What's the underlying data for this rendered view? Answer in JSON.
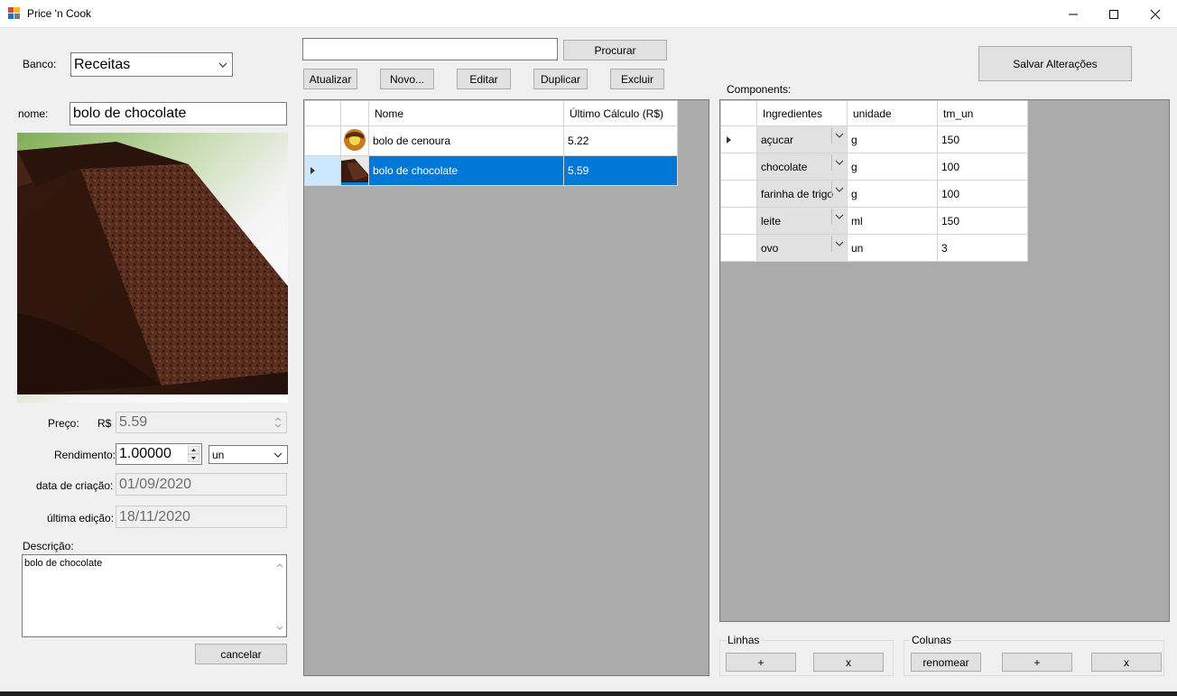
{
  "window": {
    "title": "Price 'n Cook"
  },
  "left": {
    "banco_label": "Banco:",
    "banco_value": "Receitas",
    "nome_label": "nome:",
    "nome_value": "bolo de chocolate",
    "preco_label": "Preço:",
    "currency": "R$",
    "preco_value": "5.59",
    "rendimento_label": "Rendimento:",
    "rendimento_value": "1.00000",
    "unit_value": "un",
    "criacao_label": "data de criação:",
    "criacao_value": "01/09/2020",
    "edicao_label": "última edição:",
    "edicao_value": "18/11/2020",
    "descricao_label": "Descrição:",
    "descricao_value": "bolo de chocolate",
    "cancelar_label": "cancelar"
  },
  "toolbar": {
    "search_value": "",
    "procurar_label": "Procurar",
    "atualizar_label": "Atualizar",
    "novo_label": "Novo...",
    "editar_label": "Editar",
    "duplicar_label": "Duplicar",
    "excluir_label": "Excluir"
  },
  "recipes": {
    "columns": [
      "Nome",
      "Último Cálculo (R$)"
    ],
    "rows": [
      {
        "nome": "bolo de cenoura",
        "valor": "5.22",
        "selected": false
      },
      {
        "nome": "bolo de chocolate",
        "valor": "5.59",
        "selected": true
      }
    ]
  },
  "right": {
    "salvar_label": "Salvar Alterações",
    "components_label": "Components:",
    "columns": [
      "Ingredientes",
      "unidade",
      "tm_un"
    ],
    "rows": [
      {
        "ingrediente": "açucar",
        "unidade": "g",
        "tm_un": "150",
        "current": true
      },
      {
        "ingrediente": "chocolate",
        "unidade": "g",
        "tm_un": "100",
        "current": false
      },
      {
        "ingrediente": "farinha de trigo",
        "unidade": "g",
        "tm_un": "100",
        "current": false
      },
      {
        "ingrediente": "leite",
        "unidade": "ml",
        "tm_un": "150",
        "current": false
      },
      {
        "ingrediente": "ovo",
        "unidade": "un",
        "tm_un": "3",
        "current": false
      }
    ],
    "linhas_label": "Linhas",
    "linhas_add": "+",
    "linhas_remove": "x",
    "colunas_label": "Colunas",
    "renomear_label": "renomear",
    "colunas_add": "+",
    "colunas_remove": "x"
  },
  "colors": {
    "selection": "#0078d7",
    "grid_background": "#ababab"
  }
}
